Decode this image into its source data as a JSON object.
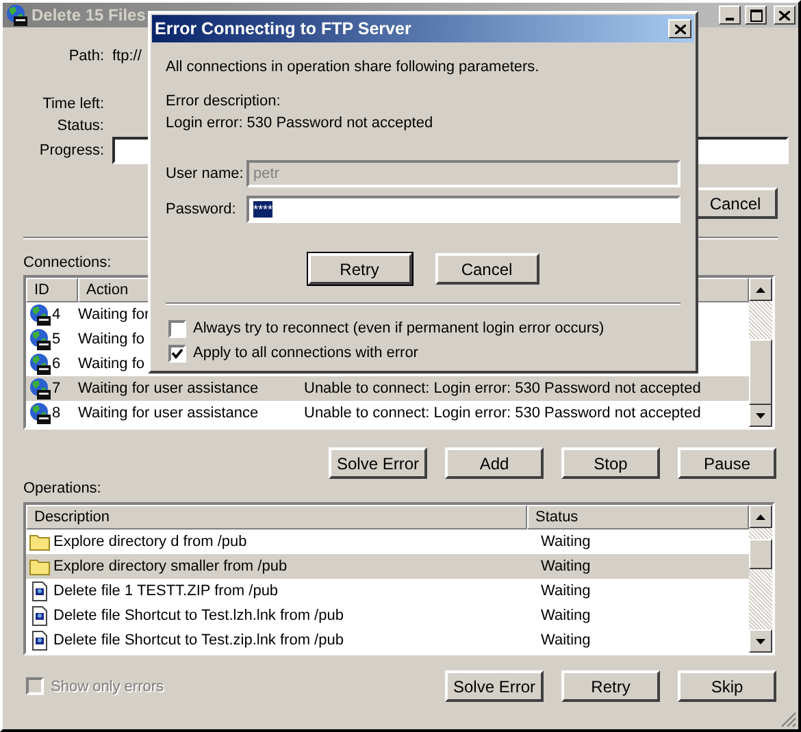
{
  "window": {
    "title": "Delete 15 Files",
    "active": false
  },
  "info": [
    {
      "label": "Path:",
      "value": "ftp://",
      "kind": "text"
    },
    {
      "label": "Time left:",
      "kind": "text"
    },
    {
      "label": "Status:",
      "kind": "text"
    },
    {
      "label": "Progress:",
      "kind": "field"
    }
  ],
  "cancel_button": "Cancel",
  "connections": {
    "label": "Connections:",
    "columns": [
      "ID",
      "Action"
    ],
    "rows": [
      {
        "id": "4",
        "action": "Waiting for",
        "selected": false
      },
      {
        "id": "5",
        "action": "Waiting fo",
        "selected": false
      },
      {
        "id": "6",
        "action": "Waiting fo",
        "selected": false
      },
      {
        "id": "7",
        "action": "Waiting for user assistance",
        "message": "Unable to connect: Login error: 530 Password not accepted",
        "selected": true
      },
      {
        "id": "8",
        "action": "Waiting for user assistance",
        "message": "Unable to connect: Login error: 530 Password not accepted",
        "selected": false
      }
    ]
  },
  "connection_buttons": [
    {
      "label": "Solve Error"
    },
    {
      "label": "Add"
    },
    {
      "label": "Stop"
    },
    {
      "label": "Pause"
    }
  ],
  "operations": {
    "label": "Operations:",
    "columns": [
      "Description",
      "Status"
    ],
    "rows": [
      {
        "kind": "folder",
        "description": "Explore directory d from /pub",
        "status": "Waiting",
        "selected": false
      },
      {
        "kind": "folder",
        "description": "Explore directory smaller from /pub",
        "status": "Waiting",
        "selected": true
      },
      {
        "kind": "file",
        "description": "Delete file 1 TESTT.ZIP from /pub",
        "status": "Waiting",
        "selected": false
      },
      {
        "kind": "file",
        "description": "Delete file Shortcut to Test.lzh.lnk from /pub",
        "status": "Waiting",
        "selected": false
      },
      {
        "kind": "file",
        "description": "Delete file Shortcut to Test.zip.lnk from /pub",
        "status": "Waiting",
        "selected": false
      }
    ]
  },
  "show_only_errors": {
    "label": "Show only errors",
    "checked": false,
    "disabled": true
  },
  "operation_buttons": [
    {
      "label": "Solve Error"
    },
    {
      "label": "Retry"
    },
    {
      "label": "Skip"
    }
  ],
  "dialog": {
    "title": "Error Connecting to FTP Server",
    "intro": "All connections in operation share following parameters.",
    "error_label": "Error description:",
    "error_text": "Login error: 530 Password not accepted",
    "fields": [
      {
        "label": "User name:",
        "value": "petr",
        "disabled": true,
        "selected": false
      },
      {
        "label": "Password:",
        "value": "****",
        "disabled": false,
        "selected": true
      }
    ],
    "buttons": [
      {
        "label": "Retry",
        "default": true
      },
      {
        "label": "Cancel",
        "default": false
      }
    ],
    "options": [
      {
        "label": "Always try to reconnect (even if permanent login error occurs)",
        "checked": false
      },
      {
        "label": "Apply to all connections with error",
        "checked": true
      }
    ]
  }
}
